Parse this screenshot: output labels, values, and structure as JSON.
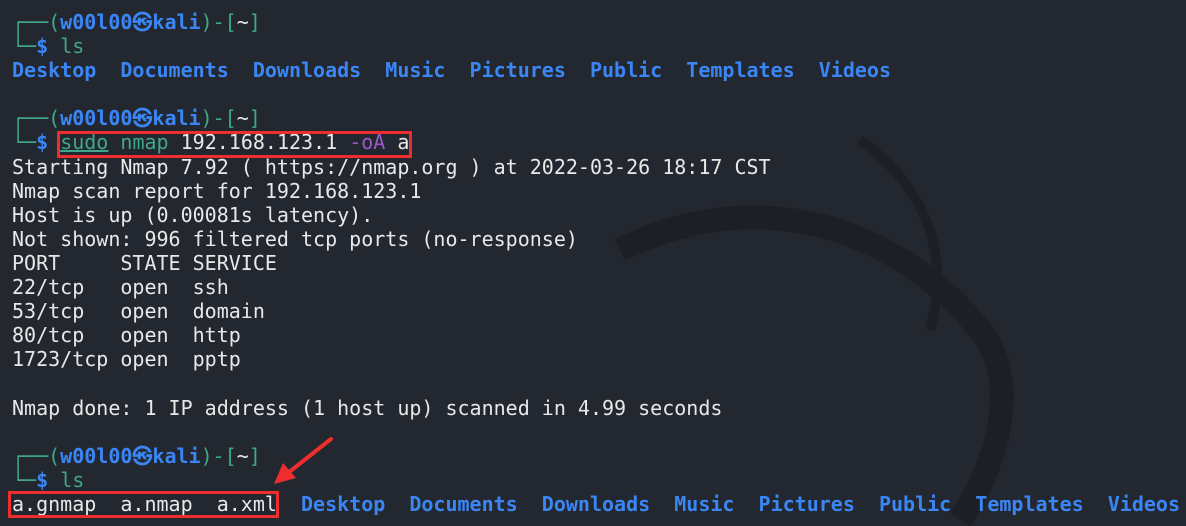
{
  "theme": {
    "background": "#23272f",
    "prompt": "#3fa88a",
    "directory": "#3b86f5",
    "highlight": "#ee2e2e",
    "option": "#9a5bc9"
  },
  "lines": [
    {
      "segs": [
        {
          "t": "┌──(",
          "c": "g"
        },
        {
          "t": "w00l00㉿kali",
          "c": "b"
        },
        {
          "t": ")-[",
          "c": "g"
        },
        {
          "t": "~",
          "c": "w"
        },
        {
          "t": "]",
          "c": "g"
        }
      ]
    },
    {
      "segs": [
        {
          "t": "└─",
          "c": "g"
        },
        {
          "t": "$ ",
          "c": "b"
        },
        {
          "t": "ls",
          "c": "g"
        }
      ]
    },
    {
      "segs": [
        {
          "t": "Desktop  Documents  Downloads  Music  Pictures  Public  Templates  Videos",
          "c": "gb"
        }
      ]
    },
    {
      "segs": []
    },
    {
      "segs": [
        {
          "t": "┌──(",
          "c": "g"
        },
        {
          "t": "w00l00㉿kali",
          "c": "b"
        },
        {
          "t": ")-[",
          "c": "g"
        },
        {
          "t": "~",
          "c": "w"
        },
        {
          "t": "]",
          "c": "g"
        }
      ]
    },
    {
      "segs": [
        {
          "t": "└─",
          "c": "g"
        },
        {
          "t": "$ ",
          "c": "b"
        },
        {
          "t": "sudo",
          "c": "u"
        },
        {
          "t": " nmap ",
          "c": "g"
        },
        {
          "t": "192.168.123.1 ",
          "c": "w"
        },
        {
          "t": "-oA",
          "c": "p"
        },
        {
          "t": " a",
          "c": "w"
        }
      ]
    },
    {
      "segs": [
        {
          "t": "Starting Nmap 7.92 ( https://nmap.org ) at 2022-03-26 18:17 CST",
          "c": "w"
        }
      ]
    },
    {
      "segs": [
        {
          "t": "Nmap scan report for 192.168.123.1",
          "c": "w"
        }
      ]
    },
    {
      "segs": [
        {
          "t": "Host is up (0.00081s latency).",
          "c": "w"
        }
      ]
    },
    {
      "segs": [
        {
          "t": "Not shown: 996 filtered tcp ports (no-response)",
          "c": "w"
        }
      ]
    },
    {
      "segs": [
        {
          "t": "PORT     STATE SERVICE",
          "c": "w"
        }
      ]
    },
    {
      "segs": [
        {
          "t": "22/tcp   open  ssh",
          "c": "w"
        }
      ]
    },
    {
      "segs": [
        {
          "t": "53/tcp   open  domain",
          "c": "w"
        }
      ]
    },
    {
      "segs": [
        {
          "t": "80/tcp   open  http",
          "c": "w"
        }
      ]
    },
    {
      "segs": [
        {
          "t": "1723/tcp open  pptp",
          "c": "w"
        }
      ]
    },
    {
      "segs": []
    },
    {
      "segs": [
        {
          "t": "Nmap done: 1 IP address (1 host up) scanned in 4.99 seconds",
          "c": "w"
        }
      ]
    },
    {
      "segs": []
    },
    {
      "segs": [
        {
          "t": "┌──(",
          "c": "g"
        },
        {
          "t": "w00l00㉿kali",
          "c": "b"
        },
        {
          "t": ")-[",
          "c": "g"
        },
        {
          "t": "~",
          "c": "w"
        },
        {
          "t": "]",
          "c": "g"
        }
      ]
    },
    {
      "segs": [
        {
          "t": "└─",
          "c": "g"
        },
        {
          "t": "$ ",
          "c": "b"
        },
        {
          "t": "ls",
          "c": "g"
        }
      ]
    },
    {
      "segs": [
        {
          "t": "a.gnmap  a.nmap  a.xml  ",
          "c": "w"
        },
        {
          "t": "Desktop  Documents  Downloads  Music  Pictures  Public  Templates  Videos",
          "c": "gb"
        }
      ]
    }
  ]
}
